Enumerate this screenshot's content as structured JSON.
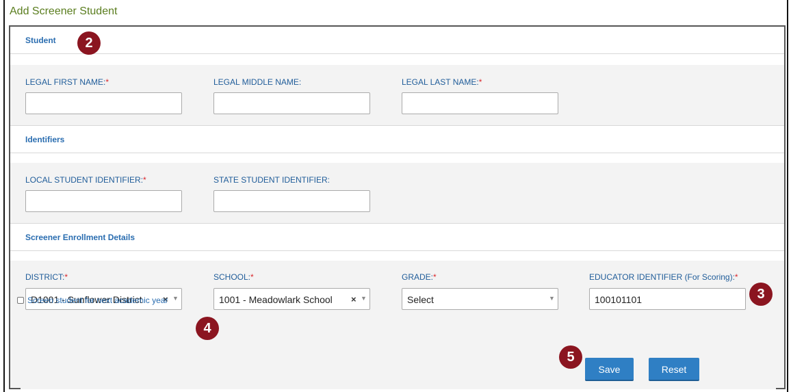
{
  "page": {
    "title": "Add Screener Student"
  },
  "sections": {
    "student": {
      "heading": "Student",
      "first_name": {
        "label": "LEGAL FIRST NAME:",
        "required": "*",
        "value": ""
      },
      "middle_name": {
        "label": "LEGAL MIDDLE NAME:",
        "value": ""
      },
      "last_name": {
        "label": "LEGAL LAST NAME:",
        "required": "*",
        "value": ""
      }
    },
    "identifiers": {
      "heading": "Identifiers",
      "local_id": {
        "label": "LOCAL STUDENT IDENTIFIER:",
        "required": "*",
        "value": ""
      },
      "state_id": {
        "label": "STATE STUDENT IDENTIFIER:",
        "value": ""
      }
    },
    "enrollment": {
      "heading": "Screener Enrollment Details",
      "district": {
        "label": "DISTRICT:",
        "required": "*",
        "value": "D1001 - Sunflower District"
      },
      "school": {
        "label": "SCHOOL:",
        "required": "*",
        "value": "1001 - Meadowlark School"
      },
      "grade": {
        "label": "GRADE:",
        "required": "*",
        "value": "Select"
      },
      "educator": {
        "label": "EDUCATOR IDENTIFIER (For Scoring):",
        "required": "*",
        "value": "100101101"
      },
      "next_year": {
        "label": "Screen student for next academic year",
        "checked": false
      }
    }
  },
  "buttons": {
    "save": "Save",
    "reset": "Reset"
  },
  "icons": {
    "clear": "×",
    "caret": "▼"
  },
  "callouts": [
    "2",
    "3",
    "4",
    "5"
  ],
  "colors": {
    "link_blue": "#2a6db0",
    "label_blue": "#1f5c99",
    "button": "#2f7fc4",
    "callout": "#8b1520",
    "required": "#d9262b",
    "title_green": "#5a7d1e"
  }
}
